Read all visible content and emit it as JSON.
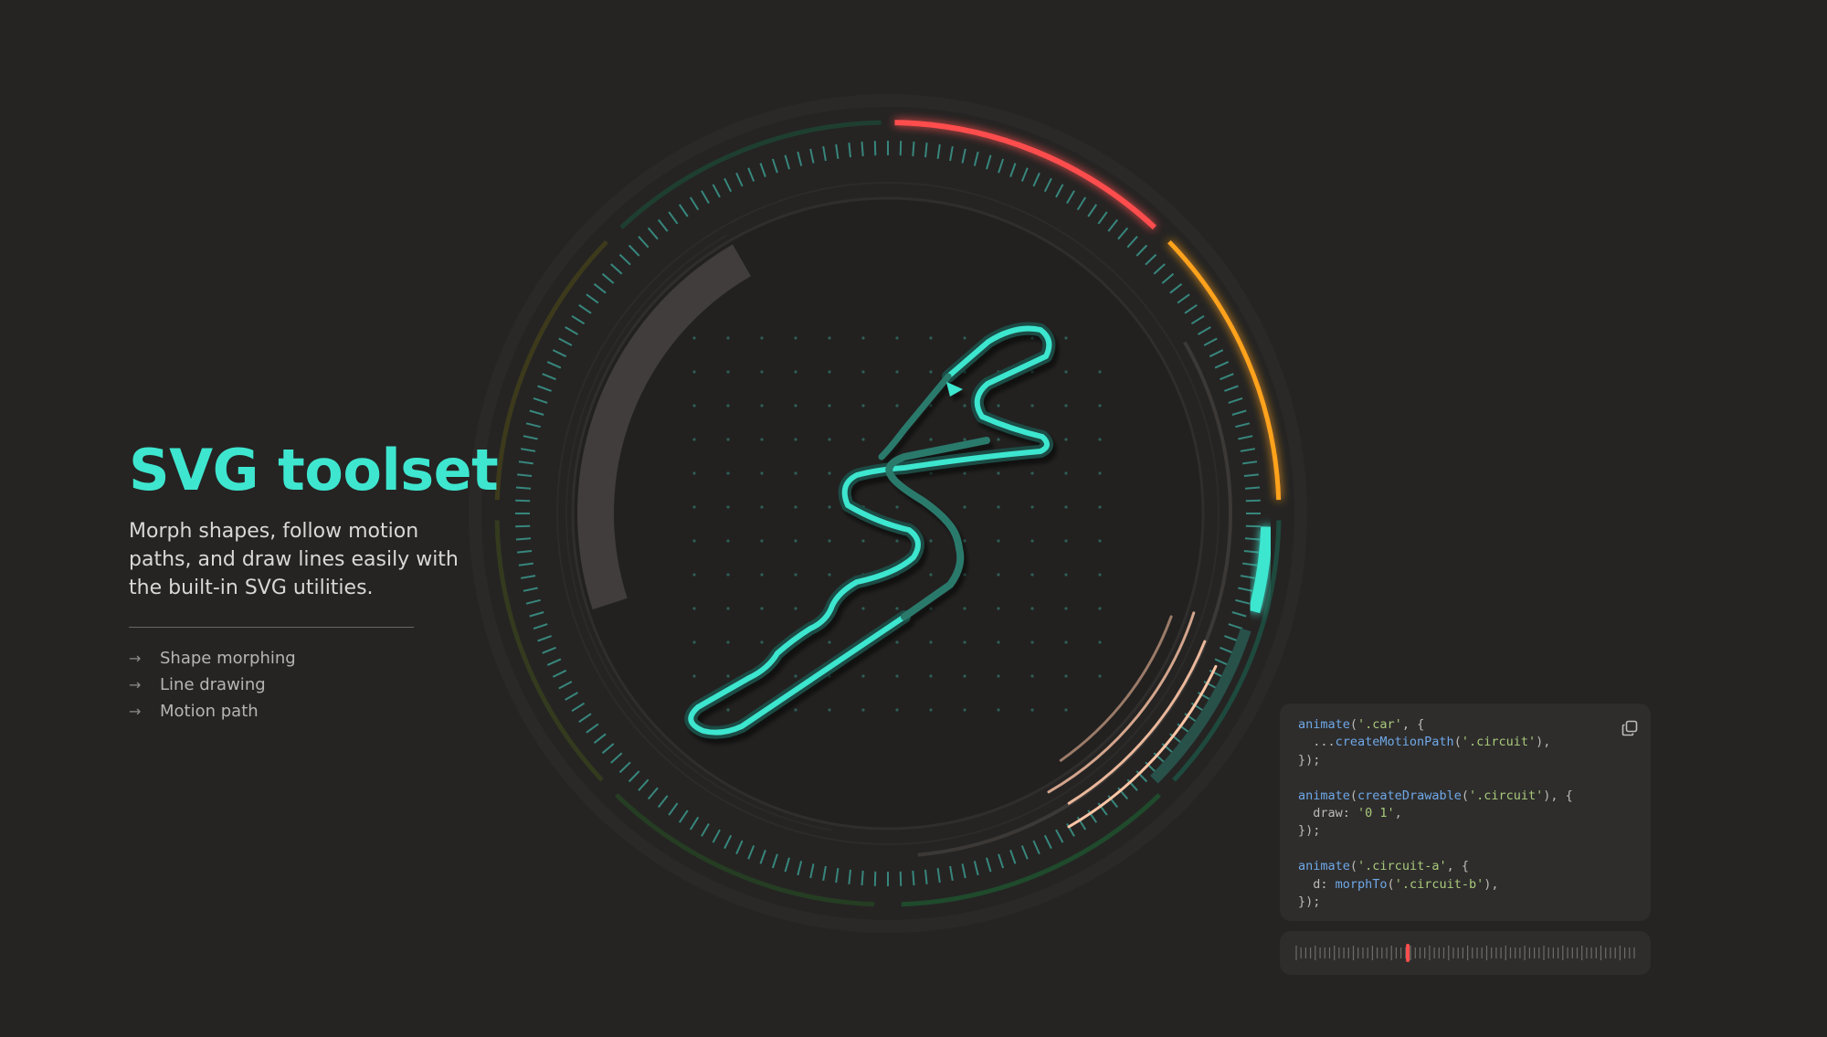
{
  "hero": {
    "title": "SVG toolset",
    "description": "Morph shapes, follow motion paths, and draw lines easily with the built-in SVG utilities.",
    "features": [
      {
        "label": "Shape morphing"
      },
      {
        "label": "Line drawing"
      },
      {
        "label": "Motion path"
      }
    ]
  },
  "code": {
    "lines": [
      [
        {
          "t": "animate",
          "c": "fn"
        },
        {
          "t": "("
        },
        {
          "t": "'.car'",
          "c": "str"
        },
        {
          "t": ", {"
        }
      ],
      [
        {
          "t": "  ..."
        },
        {
          "t": "createMotionPath",
          "c": "fn"
        },
        {
          "t": "("
        },
        {
          "t": "'.circuit'",
          "c": "str"
        },
        {
          "t": "),"
        }
      ],
      [
        {
          "t": "});"
        }
      ],
      [],
      [
        {
          "t": "animate",
          "c": "fn"
        },
        {
          "t": "("
        },
        {
          "t": "createDrawable",
          "c": "fn"
        },
        {
          "t": "("
        },
        {
          "t": "'.circuit'",
          "c": "str"
        },
        {
          "t": "), {"
        }
      ],
      [
        {
          "t": "  draw: "
        },
        {
          "t": "'0 1'",
          "c": "str"
        },
        {
          "t": ","
        }
      ],
      [
        {
          "t": "});"
        }
      ],
      [],
      [
        {
          "t": "animate",
          "c": "fn"
        },
        {
          "t": "("
        },
        {
          "t": "'.circuit-a'",
          "c": "str"
        },
        {
          "t": ", {"
        }
      ],
      [
        {
          "t": "  d: "
        },
        {
          "t": "morphTo",
          "c": "fn"
        },
        {
          "t": "("
        },
        {
          "t": "'.circuit-b'",
          "c": "str"
        },
        {
          "t": "),"
        }
      ],
      [
        {
          "t": "});"
        }
      ]
    ],
    "copy_icon": "copy-icon"
  },
  "timeline": {
    "playhead_position": 0.33
  },
  "colors": {
    "accent": "#3ee6cf",
    "red": "#ff4d4d",
    "orange": "#ffa21f",
    "peach": "#ffc6a6",
    "background": "#252423",
    "panel": "#2e2d2c"
  }
}
